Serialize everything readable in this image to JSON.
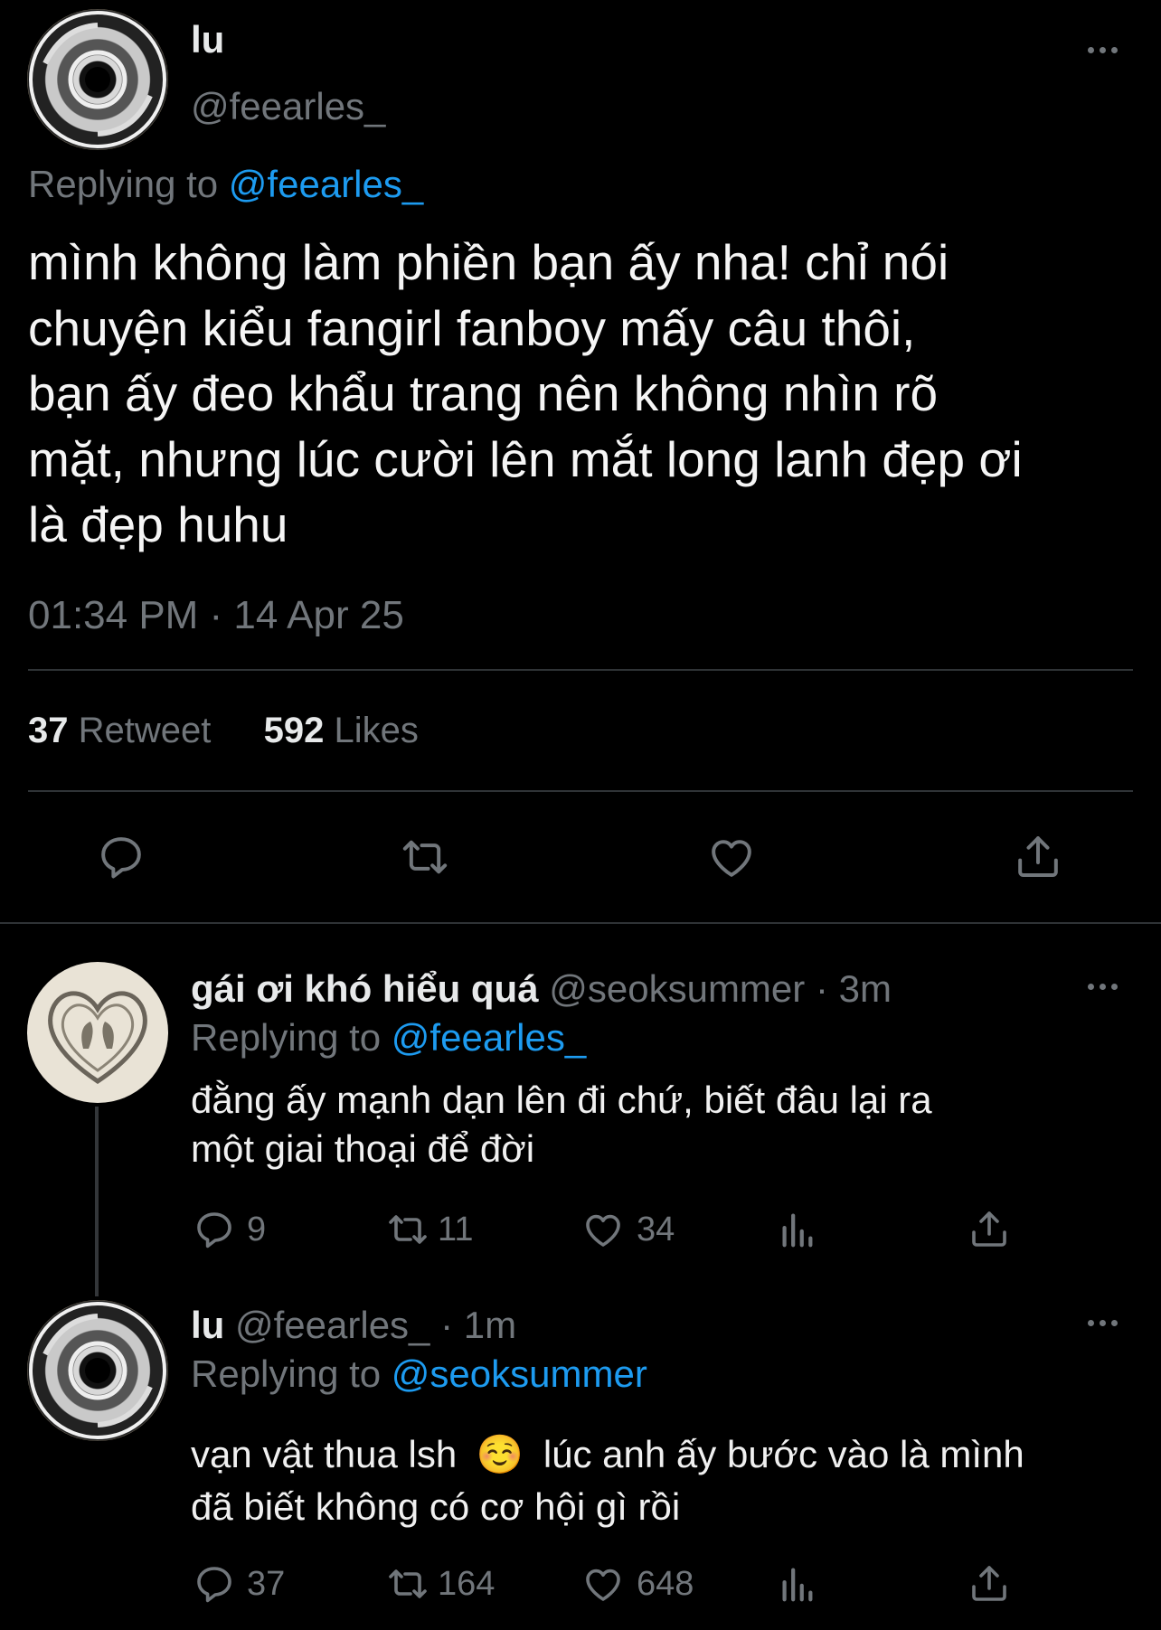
{
  "main_tweet": {
    "display_name": "lu",
    "handle": "@feearles_",
    "replying_to_prefix": "Replying to",
    "replying_to_handle": "@feearles_",
    "text_lines": [
      "mình không làm phiền bạn ấy nha! chỉ nói",
      "chuyện kiểu fangirl fanboy mấy câu thôi,",
      "bạn ấy đeo khẩu trang nên không nhìn rõ",
      "mặt, nhưng lúc cười lên mắt long lanh đẹp ơi",
      "là đẹp huhu"
    ],
    "timestamp": "01:34 PM · 14 Apr 25",
    "retweet_count": "37",
    "retweet_label": "Retweet",
    "likes_count": "592",
    "likes_label": "Likes",
    "actions": [
      "reply-icon",
      "retweet-icon",
      "like-icon",
      "share-icon"
    ]
  },
  "replies": [
    {
      "display_name": "gái ơi khó hiểu quá",
      "handle": "@seoksummer",
      "time": "· 3m",
      "replying_to_prefix": "Replying to",
      "replying_to_handle": "@feearles_",
      "text_lines": [
        "đằng ấy mạnh dạn lên đi chứ, biết đâu lại ra",
        "một giai thoại để đời"
      ],
      "reply_count": "9",
      "retweet_count": "11",
      "like_count": "34"
    },
    {
      "display_name": "lu",
      "handle": "@feearles_",
      "time": "· 1m",
      "replying_to_prefix": "Replying to",
      "replying_to_handle": "@seoksummer",
      "text_line1_before": "vạn vật thua lsh",
      "emoji": "☺️",
      "text_line1_after": "lúc anh ấy bước vào là mình",
      "text_line2": "đã biết không có cơ hội gì rồi",
      "reply_count": "37",
      "retweet_count": "164",
      "like_count": "648"
    }
  ],
  "colors": {
    "background": "#000000",
    "text": "#e7e9ea",
    "muted": "#71767b",
    "link": "#1d9bf0",
    "divider": "#2f3336"
  }
}
